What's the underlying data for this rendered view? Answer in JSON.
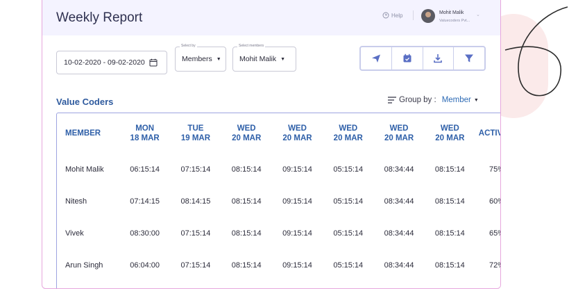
{
  "header": {
    "title": "Weekly Report",
    "help_label": "Help",
    "user_name": "Mohit Malik",
    "user_company": "Valuecoders Pvt..."
  },
  "filters": {
    "date_range": "10-02-2020 - 09-02-2020",
    "select_by_label": "Select by",
    "select_by_value": "Members",
    "select_members_label": "Select members",
    "select_members_value": "Mohit Malik"
  },
  "toolbar": {
    "icons": [
      "send-icon",
      "calendar-icon",
      "download-icon",
      "filter-icon"
    ],
    "accent": "#5a6fc4"
  },
  "section": {
    "title": "Value Coders",
    "group_by_label": "Group by :",
    "group_by_value": "Member"
  },
  "table": {
    "columns": [
      {
        "line1": "MEMBER",
        "line2": ""
      },
      {
        "line1": "MON",
        "line2": "18 MAR"
      },
      {
        "line1": "TUE",
        "line2": "19 MAR"
      },
      {
        "line1": "WED",
        "line2": "20 MAR"
      },
      {
        "line1": "WED",
        "line2": "20 MAR"
      },
      {
        "line1": "WED",
        "line2": "20 MAR"
      },
      {
        "line1": "WED",
        "line2": "20 MAR"
      },
      {
        "line1": "WED",
        "line2": "20 MAR"
      },
      {
        "line1": "ACTIVITY",
        "line2": ""
      }
    ],
    "rows": [
      [
        "Mohit Malik",
        "06:15:14",
        "07:15:14",
        "08:15:14",
        "09:15:14",
        "05:15:14",
        "08:34:44",
        "08:15:14",
        "75%"
      ],
      [
        "Nitesh",
        "07:14:15",
        "08:14:15",
        "08:15:14",
        "09:15:14",
        "05:15:14",
        "08:34:44",
        "08:15:14",
        "60%"
      ],
      [
        "Vivek",
        "08:30:00",
        "07:15:14",
        "08:15:14",
        "09:15:14",
        "05:15:14",
        "08:34:44",
        "08:15:14",
        "65%"
      ],
      [
        "Arun Singh",
        "06:04:00",
        "07:15:14",
        "08:15:14",
        "09:15:14",
        "05:15:14",
        "08:34:44",
        "08:15:14",
        "72%"
      ]
    ]
  },
  "colors": {
    "header_bg": "#f4f3ff",
    "card_border": "#e6a6dd",
    "table_header_text": "#2e5fa8",
    "section_title": "#2e5a9e"
  }
}
